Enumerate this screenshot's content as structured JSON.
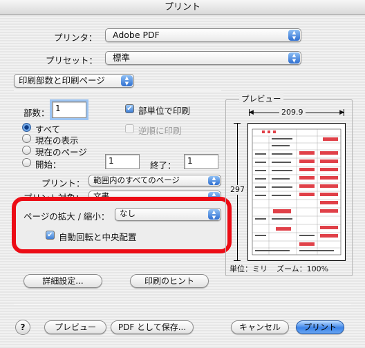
{
  "window": {
    "title": "プリント"
  },
  "printer": {
    "label": "プリンタ：",
    "value": "Adobe PDF"
  },
  "preset": {
    "label": "プリセット：",
    "value": "標準"
  },
  "panel": {
    "value": "印刷部数と印刷ページ"
  },
  "copies": {
    "label": "部数：",
    "value": "1",
    "collated_label": "部単位で印刷",
    "reverse_label": "逆順に印刷"
  },
  "pages": {
    "all_label": "すべて",
    "current_view_label": "現在の表示",
    "current_page_label": "現在のページ",
    "from_label": "開始：",
    "from_value": "1",
    "to_label": "終了：",
    "to_value": "1"
  },
  "print_what": {
    "label": "プリント：",
    "value": "範囲内のすべてのページ"
  },
  "print_target": {
    "label": "プリント対象：",
    "value": "文書"
  },
  "scaling": {
    "label": "ページの拡大 / 縮小：",
    "value": "なし",
    "autorotate_label": "自動回転と中央配置"
  },
  "preview": {
    "title": "プレビュー",
    "width": "209.9",
    "height": "297",
    "unit_label": "単位：ミリ",
    "zoom_label": "ズーム：100%"
  },
  "buttons": {
    "advanced": "詳細設定...",
    "hints": "印刷のヒント",
    "help": "?",
    "preview": "プレビュー",
    "pdf": "PDF として保存...",
    "cancel": "キャンセル",
    "print": "プリント"
  },
  "colors": {
    "highlight": "#ec0c15",
    "accent": "#3b83e8"
  }
}
